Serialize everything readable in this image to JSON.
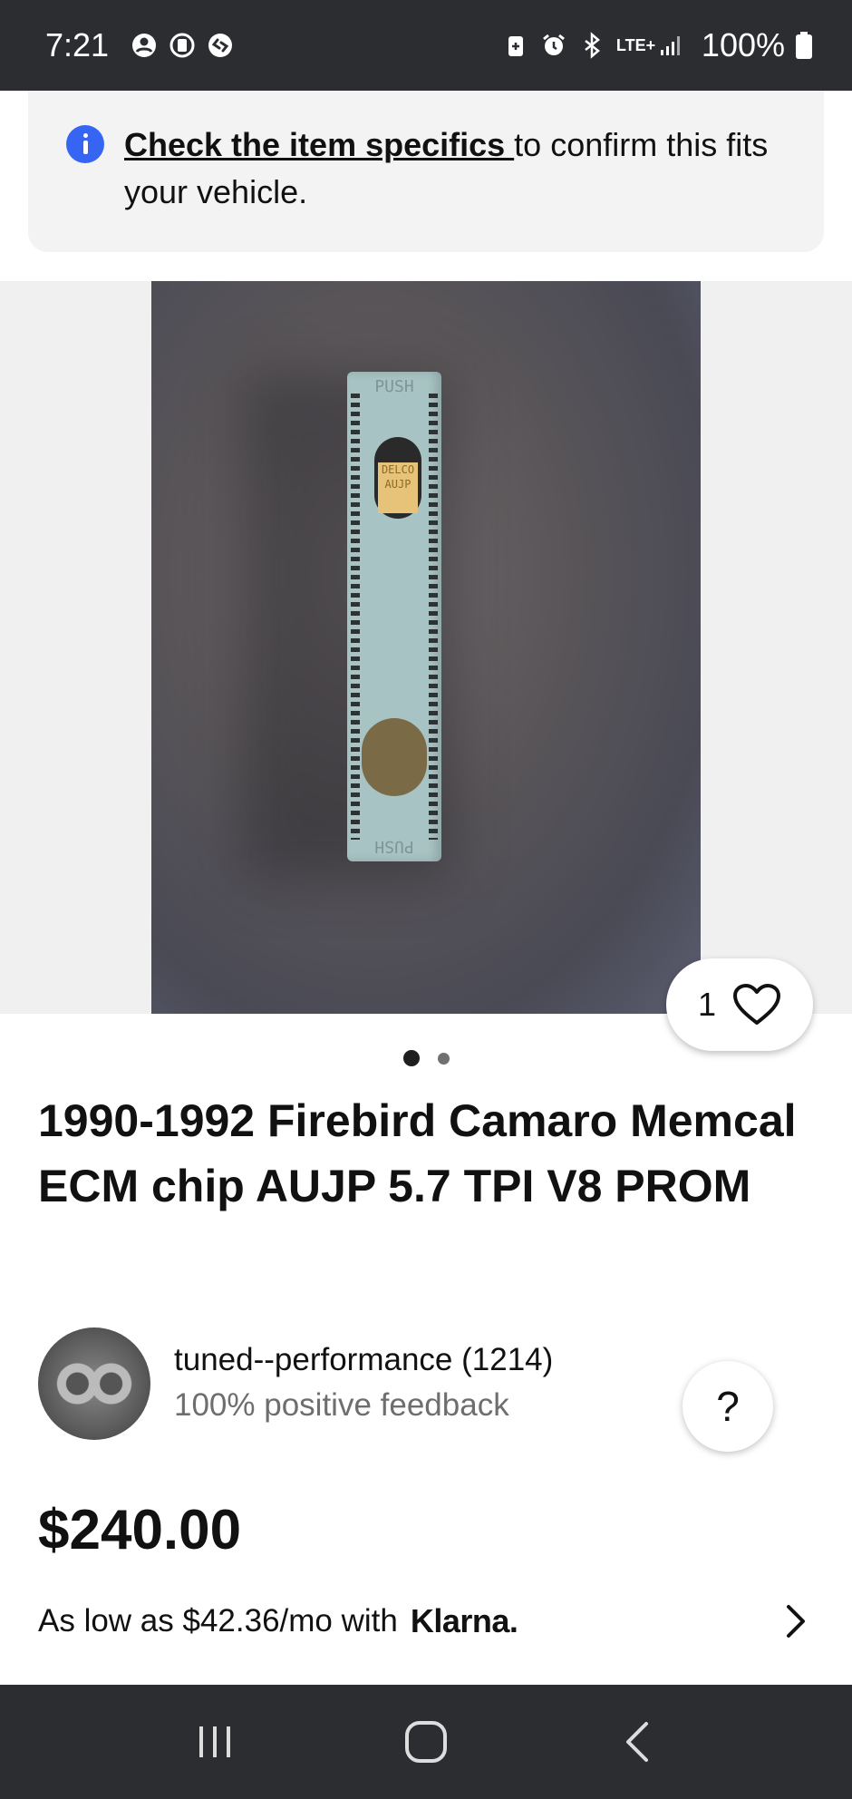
{
  "status_bar": {
    "time": "7:21",
    "left_icons": [
      "account-icon",
      "screen-record-icon",
      "shazam-icon"
    ],
    "right_icons": [
      "battery-saver-icon",
      "alarm-icon",
      "bluetooth-icon",
      "lte-icon",
      "signal-icon"
    ],
    "network": "LTE+",
    "battery": "100%"
  },
  "banner": {
    "link_text": "Check the item specifics ",
    "text": "to confirm this fits your vehicle."
  },
  "gallery": {
    "chip_label_top": "PUSH",
    "chip_label_bottom": "PUSH",
    "chip_window_text": "DELCO AUJP",
    "favorites_count": "1",
    "image_count": 2,
    "active_index": 0
  },
  "listing": {
    "title": "1990-1992 Firebird Camaro Memcal ECM chip AUJP 5.7 TPI V8 PROM",
    "seller_name": "tuned--performance (1214)",
    "seller_feedback": "100% positive feedback",
    "help_label": "?",
    "price": "$240.00",
    "financing_text": "As low as $42.36/mo with",
    "financing_brand": "Klarna."
  },
  "nav_bar": {
    "buttons": [
      "recent-apps",
      "home",
      "back"
    ]
  },
  "colors": {
    "status_bg": "#2b2d31",
    "info_blue": "#3665f3",
    "banner_bg": "#f3f3f3"
  }
}
